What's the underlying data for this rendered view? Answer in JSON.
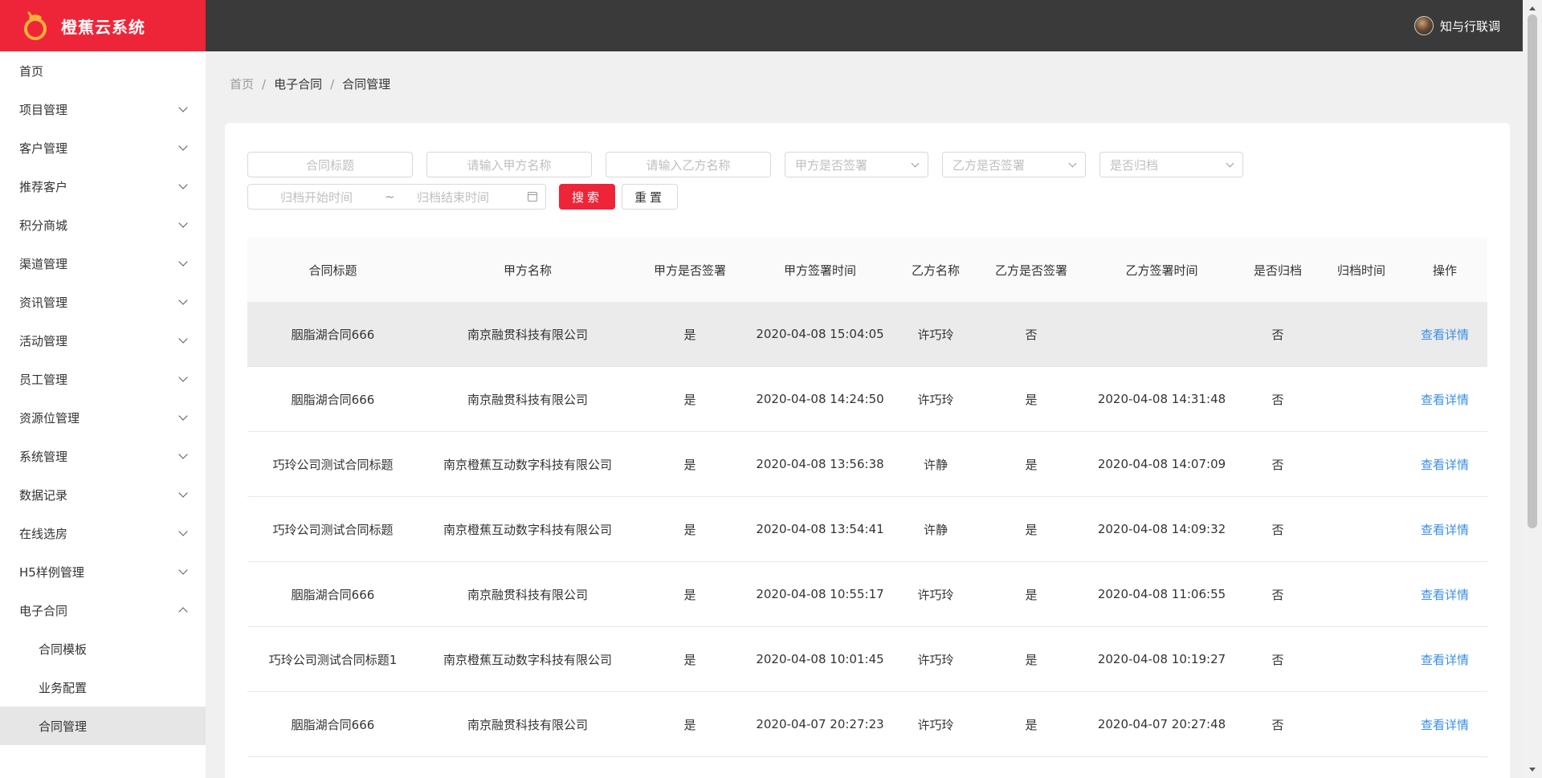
{
  "app": {
    "title": "橙蕉云系统",
    "brand_color": "#ee2538"
  },
  "header": {
    "user_name": "知与行联调"
  },
  "sidebar": {
    "items": [
      {
        "label": "首页",
        "has_children": false
      },
      {
        "label": "项目管理",
        "has_children": true
      },
      {
        "label": "客户管理",
        "has_children": true
      },
      {
        "label": "推荐客户",
        "has_children": true
      },
      {
        "label": "积分商城",
        "has_children": true
      },
      {
        "label": "渠道管理",
        "has_children": true
      },
      {
        "label": "资讯管理",
        "has_children": true
      },
      {
        "label": "活动管理",
        "has_children": true
      },
      {
        "label": "员工管理",
        "has_children": true
      },
      {
        "label": "资源位管理",
        "has_children": true
      },
      {
        "label": "系统管理",
        "has_children": true
      },
      {
        "label": "数据记录",
        "has_children": true
      },
      {
        "label": "在线选房",
        "has_children": true
      },
      {
        "label": "H5样例管理",
        "has_children": true
      },
      {
        "label": "电子合同",
        "has_children": true,
        "expanded": true
      }
    ],
    "sub_items": [
      {
        "label": "合同模板",
        "active": false
      },
      {
        "label": "业务配置",
        "active": false
      },
      {
        "label": "合同管理",
        "active": true
      }
    ]
  },
  "breadcrumb": {
    "home": "首页",
    "level1": "电子合同",
    "current": "合同管理",
    "separator": "/"
  },
  "filters": {
    "title_placeholder": "合同标题",
    "party_a_placeholder": "请输入甲方名称",
    "party_b_placeholder": "请输入乙方名称",
    "party_a_signed_placeholder": "甲方是否签署",
    "party_b_signed_placeholder": "乙方是否签署",
    "archived_placeholder": "是否归档",
    "archive_start_placeholder": "归档开始时间",
    "range_separator": "~",
    "archive_end_placeholder": "归档结束时间",
    "search_label": "搜索",
    "reset_label": "重置"
  },
  "table": {
    "columns": [
      "合同标题",
      "甲方名称",
      "甲方是否签署",
      "甲方签署时间",
      "乙方名称",
      "乙方是否签署",
      "乙方签署时间",
      "是否归档",
      "归档时间",
      "操作"
    ],
    "action_label": "查看详情",
    "rows": [
      [
        "胭脂湖合同666",
        "南京融贯科技有限公司",
        "是",
        "2020-04-08 15:04:05",
        "许巧玲",
        "否",
        "",
        "否",
        ""
      ],
      [
        "胭脂湖合同666",
        "南京融贯科技有限公司",
        "是",
        "2020-04-08 14:24:50",
        "许巧玲",
        "是",
        "2020-04-08 14:31:48",
        "否",
        ""
      ],
      [
        "巧玲公司测试合同标题",
        "南京橙蕉互动数字科技有限公司",
        "是",
        "2020-04-08 13:56:38",
        "许静",
        "是",
        "2020-04-08 14:07:09",
        "否",
        ""
      ],
      [
        "巧玲公司测试合同标题",
        "南京橙蕉互动数字科技有限公司",
        "是",
        "2020-04-08 13:54:41",
        "许静",
        "是",
        "2020-04-08 14:09:32",
        "否",
        ""
      ],
      [
        "胭脂湖合同666",
        "南京融贯科技有限公司",
        "是",
        "2020-04-08 10:55:17",
        "许巧玲",
        "是",
        "2020-04-08 11:06:55",
        "否",
        ""
      ],
      [
        "巧玲公司测试合同标题1",
        "南京橙蕉互动数字科技有限公司",
        "是",
        "2020-04-08 10:01:45",
        "许巧玲",
        "是",
        "2020-04-08 10:19:27",
        "否",
        ""
      ],
      [
        "胭脂湖合同666",
        "南京融贯科技有限公司",
        "是",
        "2020-04-07 20:27:23",
        "许巧玲",
        "是",
        "2020-04-07 20:27:48",
        "否",
        ""
      ]
    ]
  }
}
